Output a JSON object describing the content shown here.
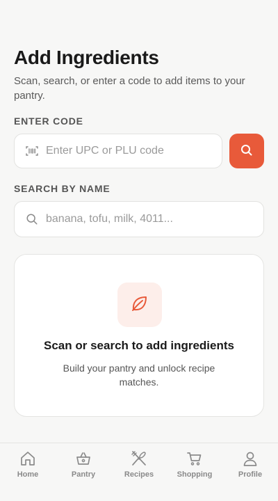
{
  "header": {
    "title": "Add Ingredients",
    "subtitle": "Scan, search, or enter a code to add items to your pantry."
  },
  "code_section": {
    "label": "ENTER CODE",
    "placeholder": "Enter UPC or PLU code",
    "value": "",
    "lead_icon": "barcode-icon",
    "button_icon": "search-icon"
  },
  "name_section": {
    "label": "SEARCH BY NAME",
    "placeholder": "banana, tofu, milk, 4011...",
    "value": "",
    "lead_icon": "search-icon"
  },
  "empty_state": {
    "icon": "leaf-icon",
    "title": "Scan or search to add ingredients",
    "text": "Build your pantry and unlock recipe matches."
  },
  "tabs": [
    {
      "label": "Home",
      "icon": "home-icon"
    },
    {
      "label": "Pantry",
      "icon": "basket-icon"
    },
    {
      "label": "Recipes",
      "icon": "utensils-icon"
    },
    {
      "label": "Shopping",
      "icon": "cart-icon"
    },
    {
      "label": "Profile",
      "icon": "person-icon"
    }
  ],
  "colors": {
    "accent": "#e85a3a",
    "accent_soft": "#fdeeea",
    "background": "#f7f7f6",
    "muted_text": "#8a8a8a"
  }
}
